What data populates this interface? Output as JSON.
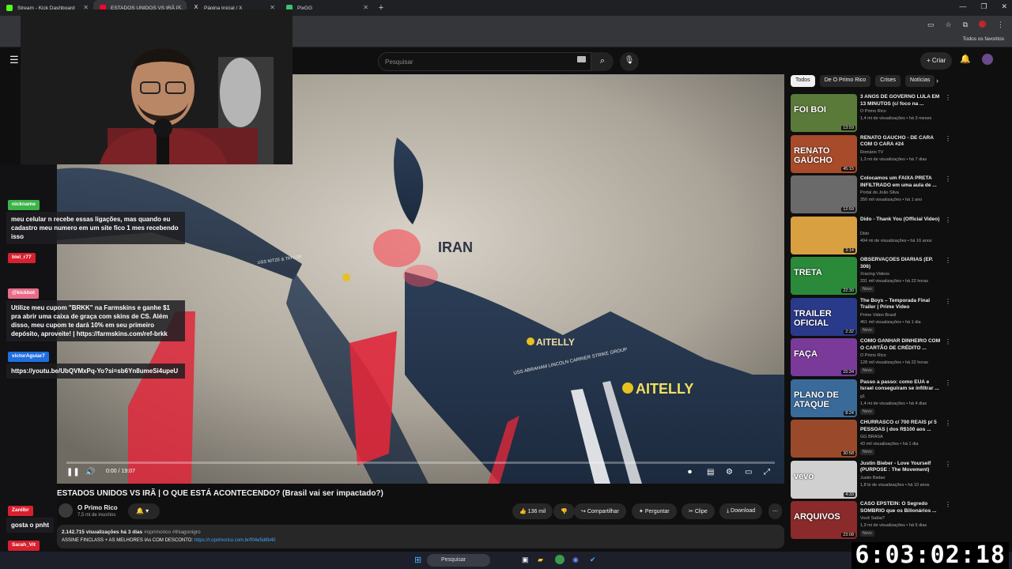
{
  "browser": {
    "tabs": [
      {
        "label": "Stream - Kick Dashboard",
        "color": "#53fc18"
      },
      {
        "label": "ESTADOS UNIDOS VS IRÃ | ...",
        "color": "#ff0033"
      },
      {
        "label": "Página Inicial / X",
        "color": "#ffffff"
      },
      {
        "label": "PixGG",
        "color": "#3cc26d"
      }
    ],
    "bookmarks_right": "Todos os favoritos"
  },
  "youtube": {
    "search_placeholder": "Pesquisar",
    "create_label": "Criar"
  },
  "player": {
    "time": "0:00 / 19:07",
    "map_labels": {
      "iran": "IRAN",
      "aitelly_1": "AITELLY",
      "aitelly_2": "AITELLY",
      "strike_group": "USS ABRAHAM LINCOLN CARRIER STRIKE GROUP",
      "ship_tag": "USS NITZE & TAYLOR"
    }
  },
  "video": {
    "title": "ESTADOS UNIDOS VS IRÃ | O QUE ESTÁ ACONTECENDO? (Brasil vai ser impactado?)",
    "channel": "O Primo Rico",
    "subscribers": "7,5 mi de inscritos",
    "likes": "136 mil",
    "share": "Compartilhar",
    "ask": "Perguntar",
    "clip": "Clipe",
    "download": "Download",
    "views_date": "2.142.715 visualizações  há 3 dias",
    "tags": "#oprimorico #thiagonigro",
    "desc_line": "ASSINE FINCLASS + AS MELHORES IAs COM DESCONTO: ",
    "desc_link": "https://r.oprimorico.com.br/f04e5d8b40"
  },
  "chips": [
    "Todos",
    "De O Primo Rico",
    "Crises",
    "Notícias"
  ],
  "recommendations": [
    {
      "title": "3 ANOS DE GOVERNO LULA EM 13 MINUTOS (c/ foco na ...",
      "channel": "O Primo Rico",
      "meta": "1,4 mi de visualizações • há 3 meses",
      "duration": "13:59",
      "thumb": "#5a7a3a",
      "thumb_text": "FOI BOI",
      "new": ""
    },
    {
      "title": "RENATO GAÚCHO - DE CARA COM O CARA #24",
      "channel": "Romário TV",
      "meta": "1,3 mi de visualizações • há 7 dias",
      "duration": "45:15",
      "thumb": "#a84b2a",
      "thumb_text": "RENATO GAÚCHO",
      "new": ""
    },
    {
      "title": "Colocamos um FAIXA PRETA INFILTRADO em uma aula de ...",
      "channel": "Portal do João Silva",
      "meta": "350 mil visualizações • há 1 ano",
      "duration": "12:59",
      "thumb": "#6a6a6a",
      "thumb_text": "",
      "new": ""
    },
    {
      "title": "Dido - Thank You (Official Video)",
      "channel": "Dido",
      "meta": "494 mi de visualizações • há 16 anos",
      "duration": "3:14",
      "thumb": "#d8a040",
      "thumb_text": "",
      "new": ""
    },
    {
      "title": "OBSERVAÇÕES DIÁRIAS (EP. 306)",
      "channel": "Xracing Videos",
      "meta": "331 mil visualizações • há 22 horas",
      "duration": "22:30",
      "thumb": "#2a8a3a",
      "thumb_text": "TRETA",
      "new": "Novo"
    },
    {
      "title": "The Boys – Temporada Final Trailer | Prime Video",
      "channel": "Prime Video Brasil",
      "meta": "461 mil visualizações • há 1 dia",
      "duration": "2:32",
      "thumb": "#2a3a8a",
      "thumb_text": "TRAILER OFICIAL",
      "new": "Novo"
    },
    {
      "title": "COMO GANHAR DINHEIRO COM O CARTÃO DE CRÉDITO ...",
      "channel": "O Primo Rico",
      "meta": "128 mil visualizações • há 22 horas",
      "duration": "15:34",
      "thumb": "#7a3a9a",
      "thumb_text": "FAÇA",
      "new": "Novo"
    },
    {
      "title": "Passo a passo: como EUA e Israel conseguiram se infiltrar ...",
      "channel": "g1",
      "meta": "1,4 mi de visualizações • há 4 dias",
      "duration": "8:24",
      "thumb": "#3a6a9a",
      "thumb_text": "PLANO DE ATAQUE",
      "new": "Novo"
    },
    {
      "title": "CHURRASCO c/ 700 REAIS p/ 5 PESSOAS | dos R$100 aos ...",
      "channel": "GG BRASA",
      "meta": "43 mil visualizações • há 1 dia",
      "duration": "30:58",
      "thumb": "#9a4a2a",
      "thumb_text": "",
      "new": "Novo"
    },
    {
      "title": "Justin Bieber - Love Yourself (PURPOSE : The Movement)",
      "channel": "Justin Bieber",
      "meta": "1,8 bi de visualizações • há 10 anos",
      "duration": "4:33",
      "thumb": "#d0d0d0",
      "thumb_text": "vevo",
      "new": ""
    },
    {
      "title": "CASO EPSTEIN: O Segredo SOMBRIO que os Bilionários ...",
      "channel": "Você Sabia?",
      "meta": "1,9 mi de visualizações • há 6 dias",
      "duration": "23:08",
      "thumb": "#8a2a2a",
      "thumb_text": "ARQUIVOS",
      "new": "Novo"
    }
  ],
  "chat": [
    {
      "user": "nickname",
      "color": "#3bb34a",
      "message": "meu celular n recebe essas ligações, mas quando eu cadastro meu numero em um site fico 1 mes recebendo isso"
    },
    {
      "user": "biel_r77",
      "color": "#d8202f",
      "message": ""
    },
    {
      "user": "@kickbot",
      "color": "#e86c8a",
      "message": "Utilize meu cupom \"BRKK\" na Farmskins e ganhe $1 pra abrir uma caixa de graça com skins de CS. Além disso, meu cupom te dará 10% em seu primeiro depósito, aproveite! | https://farmskins.com/ref-brkk"
    },
    {
      "user": "victorAguiar7",
      "color": "#1f6fe0",
      "message": "https://youtu.be/UbQVMxPq-Yo?si=sb6Yn8umeSi4upeU"
    },
    {
      "user": "Zanilbr",
      "color": "#d8202f",
      "message": "gosta o pnht"
    },
    {
      "user": "Sarah_Vit",
      "color": "#d8202f",
      "message": ""
    }
  ],
  "taskbar": {
    "search": "Pesquisar"
  },
  "clock": "6:03:02:18"
}
